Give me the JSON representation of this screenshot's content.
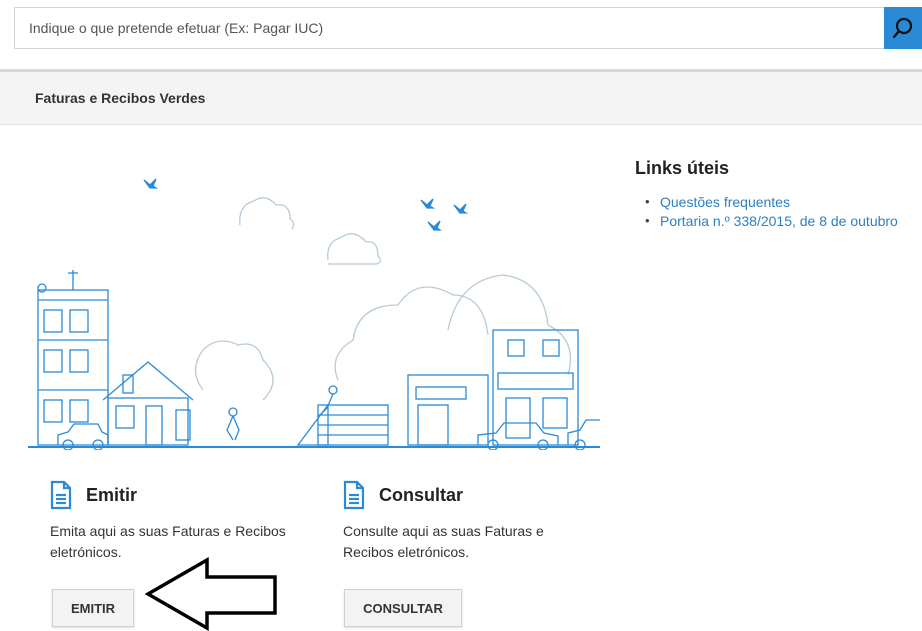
{
  "search": {
    "placeholder": "Indique o que pretende efetuar (Ex: Pagar IUC)",
    "icon": "search-icon"
  },
  "subheader": {
    "title": "Faturas e Recibos Verdes"
  },
  "links": {
    "title": "Links úteis",
    "items": [
      {
        "label": "Questões frequentes"
      },
      {
        "label": "Portaria n.º 338/2015, de 8 de outubro"
      }
    ]
  },
  "cards": [
    {
      "title": "Emitir",
      "desc": "Emita aqui as suas Faturas e Recibos eletrónicos.",
      "button": "EMITIR",
      "icon": "document-icon"
    },
    {
      "title": "Consultar",
      "desc": "Consulte aqui as suas Faturas e Recibos eletrónicos.",
      "button": "CONSULTAR",
      "icon": "document-icon"
    }
  ],
  "colors": {
    "accent": "#2b8ad6",
    "link": "#2b7fc3",
    "illustration": "#2b8ad6"
  }
}
